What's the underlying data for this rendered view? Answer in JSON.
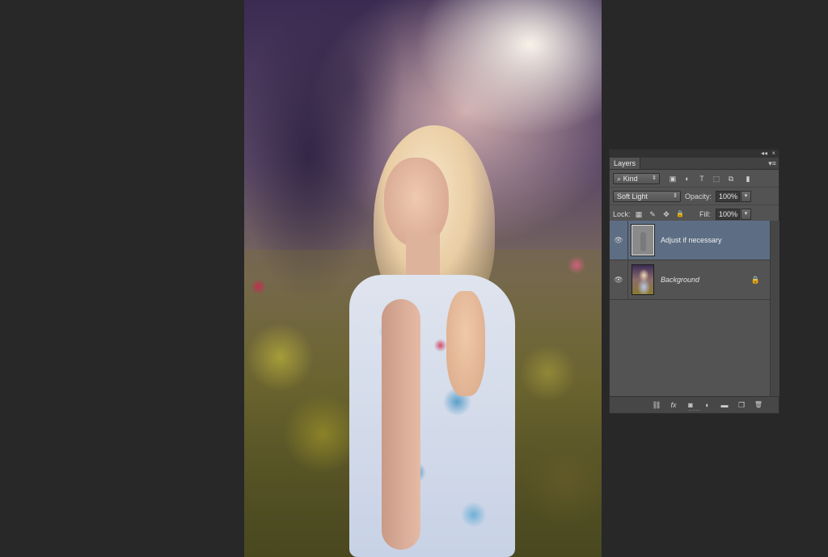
{
  "layers_panel": {
    "tab_label": "Layers",
    "top_controls": {
      "collapse_glyph": "◂◂",
      "close_glyph": "×"
    },
    "menu_glyph": "▾≡",
    "filter": {
      "kind_label": "Kind",
      "search_glyph": "⌕",
      "icons": [
        "image-filter-icon",
        "adjustment-filter-icon",
        "type-filter-icon",
        "shape-filter-icon",
        "smart-object-filter-icon",
        "filter-toggle-icon"
      ],
      "icon_glyphs": [
        "▣",
        "◐",
        "T",
        "⬚",
        "⧉",
        "▮"
      ]
    },
    "blend_mode": "Soft Light",
    "opacity_label": "Opacity:",
    "opacity_value": "100%",
    "lock_label": "Lock:",
    "lock_icons": [
      "lock-transparent-icon",
      "lock-image-icon",
      "lock-position-icon",
      "lock-all-icon"
    ],
    "lock_glyphs": [
      "▦",
      "✎",
      "✥",
      "🔒"
    ],
    "fill_label": "Fill:",
    "fill_value": "100%",
    "layers": [
      {
        "name": "Adjust if necessary",
        "selected": true,
        "visible": true,
        "locked": false
      },
      {
        "name": "Background",
        "selected": false,
        "visible": true,
        "locked": true
      }
    ],
    "eye_glyph": "👁",
    "lock_glyph": "🔒",
    "footer_tools": [
      {
        "name": "link-layers-icon",
        "glyph": "⛓"
      },
      {
        "name": "fx-icon",
        "glyph": "fx"
      },
      {
        "name": "add-mask-icon",
        "glyph": "◙"
      },
      {
        "name": "new-adjustment-icon",
        "glyph": "◐"
      },
      {
        "name": "new-group-icon",
        "glyph": "▬"
      },
      {
        "name": "new-layer-icon",
        "glyph": "❐"
      },
      {
        "name": "delete-layer-icon",
        "glyph": "🗑"
      }
    ]
  }
}
